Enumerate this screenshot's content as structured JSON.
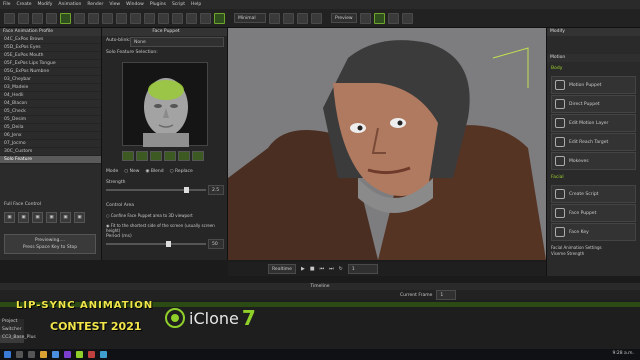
{
  "menu": [
    "File",
    "Create",
    "Modify",
    "Animation",
    "Render",
    "View",
    "Window",
    "Plugins",
    "Script",
    "Help"
  ],
  "toolbar": {
    "shading": "Minimal",
    "preview": "Preview"
  },
  "left": {
    "title": "Face Animation Profile",
    "items": [
      "04C_ExPos Brows",
      "05D_ExPos Eyes",
      "05E_ExPos Mouth",
      "05F_ExPos Lips Tongue",
      "05G_ExPos Numbne",
      "03_Cheybar",
      "03_Madeie",
      "04_Hedli",
      "04_Blacon",
      "05_Check",
      "05_Desim",
      "05_Deila",
      "06_Jenx",
      "07_Jocmo",
      "30C_Custom",
      "Solo Feature"
    ],
    "selected": "Solo Feature",
    "control_title": "Full Face Control",
    "status": "Previewing....",
    "stop": "Press Space Key to Stop"
  },
  "center": {
    "title": "Face Puppet",
    "auto_blink_label": "Auto-blink:",
    "auto_blink": "None",
    "solo_label": "Solo Feature Selection:",
    "mode_label": "Mode",
    "modes": [
      "New",
      "Blend",
      "Replace"
    ],
    "strength_label": "Strength",
    "strength": "2.5",
    "control_area": "Control Area",
    "opt1": "Confine Face Puppet area to 3D viewport",
    "opt2": "Fit to the shortest side of the screen (usually screen height)",
    "period_label": "Period (ms)",
    "period": "50"
  },
  "right": {
    "title": "Modify",
    "motion": "Motion",
    "body": "Body",
    "buttons": [
      "Motion Puppet",
      "Direct Puppet",
      "Edit Motion Layer",
      "Edit Reach Target",
      "Mokeves"
    ],
    "facial": "Facial",
    "facial_buttons": [
      "Create Script",
      "Face Puppet",
      "Face Key"
    ],
    "fa_settings": "Facial Animation Settings",
    "visemes": "Viseme Strength"
  },
  "playbar": {
    "mode": "Realtime",
    "frame": "1"
  },
  "timeline": {
    "title": "Timeline",
    "current_label": "Current Frame",
    "current": "1",
    "tracks": [
      "Project",
      "Switcher",
      "CC3_Base_Plus"
    ]
  },
  "banner": {
    "line1": "LIP-SYNC ANIMATION",
    "line2": "CONTEST 2021",
    "brand": "iClone",
    "version": "7"
  },
  "clock": "9:28 a.m."
}
